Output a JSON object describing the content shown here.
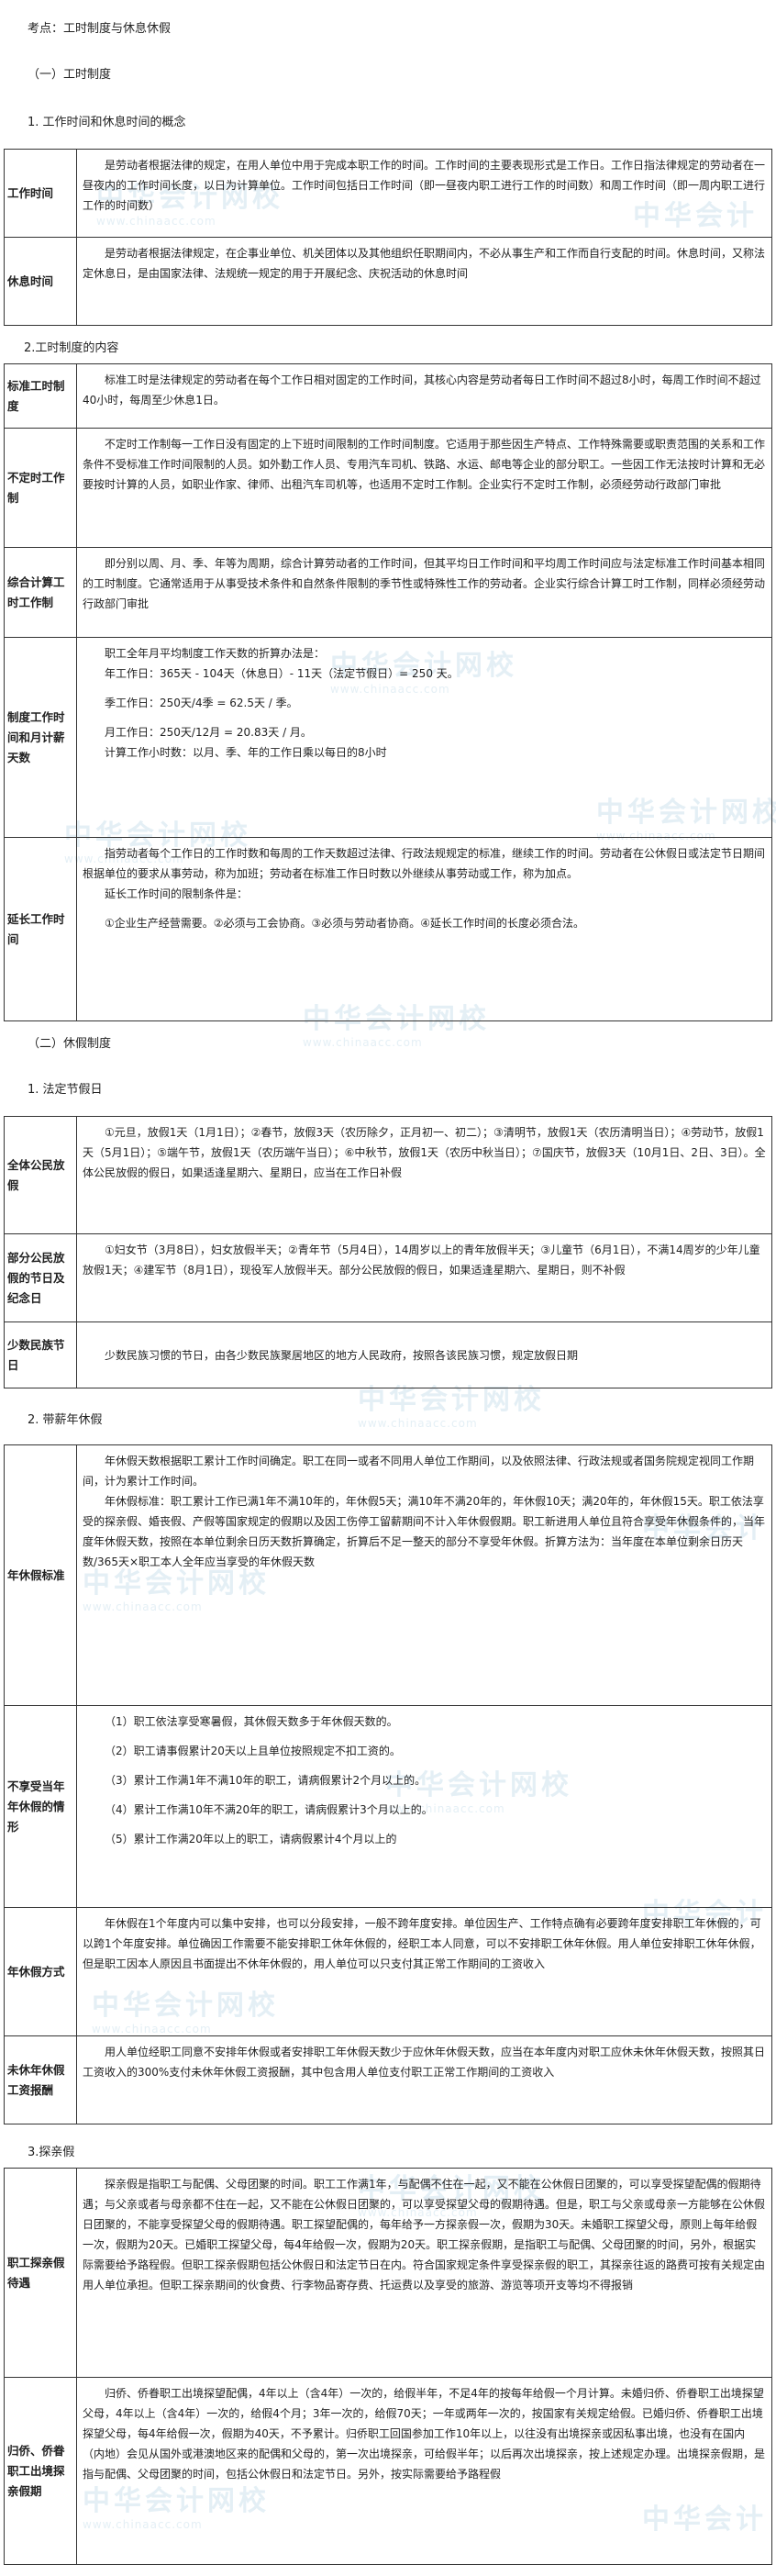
{
  "heading": {
    "topic": "考点：工时制度与休息休假",
    "part1": "（一）工时制度",
    "s1": "1. 工作时间和休息时间的概念",
    "s2": "2.工时制度的内容",
    "part2": "（二）休假制度",
    "s3": "1. 法定节假日",
    "s4": "2. 带薪年休假",
    "s5": "3.探亲假"
  },
  "watermark": {
    "text": "中华会计网校",
    "url": "www.chinaacc.com"
  },
  "t1": {
    "r1": {
      "label": "工作时间",
      "lines": [
        "是劳动者根据法律的规定，在用人单位中用于完成本职工作的时间。工作时间的主要表现形式是工作日。工作日指法律规定的劳动者在一昼夜内的工作时间长度，以日为计算单位。工作时间包括日工作时间（即一昼夜内职工进行工作的时间数）和周工作时间（即一周内职工进行工作的时间数）"
      ]
    },
    "r2": {
      "label": "休息时间",
      "lines": [
        "是劳动者根据法律规定，在企事业单位、机关团体以及其他组织任职期间内，不必从事生产和工作而自行支配的时间。休息时间，又称法定休息日，是由国家法律、法规统一规定的用于开展纪念、庆祝活动的休息时间"
      ]
    }
  },
  "t2": {
    "r1": {
      "label": "标准工时制度",
      "lines": [
        "标准工时是法律规定的劳动者在每个工作日相对固定的工作时间，其核心内容是劳动者每日工作时间不超过8小时，每周工作时间不超过40小时，每周至少休息1日。"
      ]
    },
    "r2": {
      "label": "不定时工作制",
      "lines": [
        "不定时工作制每一工作日没有固定的上下班时间限制的工作时间制度。它适用于那些因生产特点、工作特殊需要或职责范围的关系和工作条件不受标准工作时间限制的人员。如外勤工作人员、专用汽车司机、铁路、水运、邮电等企业的部分职工。一些因工作无法按时计算和无必要按时计算的人员，如职业作家、律师、出租汽车司机等，也适用不定时工作制。企业实行不定时工作制，必须经劳动行政部门审批"
      ]
    },
    "r3": {
      "label": "综合计算工时工作制",
      "lines": [
        "即分别以周、月、季、年等为周期，综合计算劳动者的工作时间，但其平均日工作时间和平均周工作时间应与法定标准工作时间基本相同的工时制度。它通常适用于从事受技术条件和自然条件限制的季节性或特殊性工作的劳动者。企业实行综合计算工时工作制，同样必须经劳动行政部门审批"
      ]
    },
    "r4": {
      "label": "制度工作时间和月计薪天数",
      "intro": "职工全年月平均制度工作天数的折算办法是：",
      "items": [
        "年工作日：365天 - 104天（休息日）- 11天（法定节假日）= 250 天。",
        "季工作日：250天/4季 = 62.5天 / 季。",
        "月工作日：250天/12月 = 20.83天 / 月。",
        "计算工作小时数：以月、季、年的工作日乘以每日的8小时"
      ]
    },
    "r5": {
      "label": "延长工作时间",
      "lines": [
        "指劳动者每个工作日的工作时数和每周的工作天数超过法律、行政法规规定的标准，继续工作的时间。劳动者在公休假日或法定节日期间根据单位的要求从事劳动，称为加班；劳动者在标准工作日时数以外继续从事劳动或工作，称为加点。"
      ],
      "sub_intro": "延长工作时间的限制条件是：",
      "sub": "①企业生产经营需要。②必须与工会协商。③必须与劳动者协商。④延长工作时间的长度必须合法。"
    }
  },
  "t3": {
    "r1": {
      "label": "全体公民放假",
      "lines": [
        "①元旦，放假1天（1月1日）；②春节，放假3天（农历除夕，正月初一、初二）；③清明节，放假1天（农历清明当日）；④劳动节，放假1天（5月1日）；⑤端午节，放假1天（农历端午当日）；⑥中秋节，放假1天（农历中秋当日）；⑦国庆节，放假3天（10月1日、2日、3日）。全体公民放假的假日，如果适逢星期六、星期日，应当在工作日补假"
      ]
    },
    "r2": {
      "label": "部分公民放假的节日及纪念日",
      "lines": [
        "①妇女节（3月8日），妇女放假半天；②青年节（5月4日），14周岁以上的青年放假半天；③儿童节（6月1日），不满14周岁的少年儿童放假1天；④建军节（8月1日），现役军人放假半天。部分公民放假的假日，如果适逢星期六、星期日，则不补假"
      ]
    },
    "r3": {
      "label": "少数民族节日",
      "lines": [
        "少数民族习惯的节日，由各少数民族聚居地区的地方人民政府，按照各该民族习惯，规定放假日期"
      ]
    }
  },
  "t4": {
    "r1": {
      "label": "年休假标准",
      "lines": [
        "年休假天数根据职工累计工作时间确定。职工在同一或者不同用人单位工作期间，以及依照法律、行政法规或者国务院规定视同工作期间，计为累计工作时间。",
        "年休假标准：职工累计工作已满1年不满10年的，年休假5天；满10年不满20年的，年休假10天；满20年的，年休假15天。职工依法享受的探亲假、婚丧假、产假等国家规定的假期以及因工伤停工留薪期间不计入年休假假期。职工新进用人单位且符合享受年休假条件的，当年度年休假天数，按照在本单位剩余日历天数折算确定，折算后不足一整天的部分不享受年休假。折算方法为：当年度在本单位剩余日历天数/365天×职工本人全年应当享受的年休假天数"
      ]
    },
    "r2": {
      "label": "不享受当年年休假的情形",
      "items": [
        "（1）职工依法享受寒暑假，其休假天数多于年休假天数的。",
        "（2）职工请事假累计20天以上且单位按照规定不扣工资的。",
        "（3）累计工作满1年不满10年的职工，请病假累计2个月以上的。",
        "（4）累计工作满10年不满20年的职工，请病假累计3个月以上的。",
        "（5）累计工作满20年以上的职工，请病假累计4个月以上的"
      ]
    },
    "r3": {
      "label": "年休假方式",
      "lines": [
        "年休假在1个年度内可以集中安排，也可以分段安排，一般不跨年度安排。单位因生产、工作特点确有必要跨年度安排职工年休假的，可以跨1个年度安排。单位确因工作需要不能安排职工休年休假的，经职工本人同意，可以不安排职工休年休假。用人单位安排职工休年休假，但是职工因本人原因且书面提出不休年休假的，用人单位可以只支付其正常工作期间的工资收入"
      ]
    },
    "r4": {
      "label": "未休年休假工资报酬",
      "lines": [
        "用人单位经职工同意不安排年休假或者安排职工年休假天数少于应休年休假天数，应当在本年度内对职工应休未休年休假天数，按照其日工资收入的300%支付未休年休假工资报酬，其中包含用人单位支付职工正常工作期间的工资收入"
      ]
    }
  },
  "t5": {
    "r1": {
      "label": "职工探亲假待遇",
      "lines": [
        "探亲假是指职工与配偶、父母团聚的时间。职工工作满1年，与配偶不住在一起，又不能在公休假日团聚的，可以享受探望配偶的假期待遇；与父亲或者与母亲都不住在一起，又不能在公休假日团聚的，可以享受探望父母的假期待遇。但是，职工与父亲或母亲一方能够在公休假日团聚的，不能享受探望父母的假期待遇。职工探望配偶的，每年给予一方探亲假一次，假期为30天。未婚职工探望父母，原则上每年给假一次，假期为20天。已婚职工探望父母，每4年给假一次，假期为20天。职工探亲假期，是指职工与配偶、父母团聚的时间，另外，根据实际需要给予路程假。但职工探亲假期包括公休假日和法定节日在内。符合国家规定条件享受探亲假的职工，其探亲往返的路费可按有关规定由用人单位承担。但职工探亲期间的伙食费、行李物品寄存费、托运费以及享受的旅游、游览等项开支等均不得报销"
      ]
    },
    "r2": {
      "label": "归侨、侨眷职工出境探亲假期",
      "lines": [
        "归侨、侨眷职工出境探望配偶，4年以上（含4年）一次的，给假半年，不足4年的按每年给假一个月计算。未婚归侨、侨眷职工出境探望父母，4年以上（含4年）一次的，给假4个月；3年一次的，给假70天；一年或两年一次的，按国家有关规定给假。已婚归侨、侨眷职工出境探望父母，每4年给假一次，假期为40天，不予累计。归侨职工回国参加工作10年以上，以往没有出境探亲或因私事出境，也没有在国内（内地）会见从国外或港澳地区来的配偶和父母的，第一次出境探亲，可给假半年；以后再次出境探亲，按上述规定办理。出境探亲假期，是指与配偶、父母团聚的时间，包括公休假日和法定节日。另外，按实际需要给予路程假"
      ]
    }
  }
}
